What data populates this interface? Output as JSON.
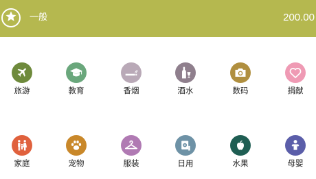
{
  "header": {
    "title": "一般",
    "amount": "200.00",
    "icon": "star-icon",
    "background": "#b5b84f"
  },
  "categories": [
    {
      "label": "旅游",
      "icon": "airplane-icon",
      "color": "#6e8a3c"
    },
    {
      "label": "教育",
      "icon": "graduation-cap-icon",
      "color": "#6aa77c"
    },
    {
      "label": "香烟",
      "icon": "cigarette-icon",
      "color": "#b9a9b7"
    },
    {
      "label": "酒水",
      "icon": "bottle-glass-icon",
      "color": "#8f7f8d"
    },
    {
      "label": "数码",
      "icon": "camera-icon",
      "color": "#b08f3f"
    },
    {
      "label": "捐献",
      "icon": "heart-icon",
      "color": "#ef9ab4"
    },
    {
      "label": "家庭",
      "icon": "family-icon",
      "color": "#e0613d"
    },
    {
      "label": "宠物",
      "icon": "paw-icon",
      "color": "#c9882a"
    },
    {
      "label": "服装",
      "icon": "hanger-icon",
      "color": "#b07ab3"
    },
    {
      "label": "日用",
      "icon": "toilet-paper-icon",
      "color": "#6e92a6"
    },
    {
      "label": "水果",
      "icon": "apple-icon",
      "color": "#1f5e53"
    },
    {
      "label": "母婴",
      "icon": "baby-icon",
      "color": "#5b5ea9"
    }
  ]
}
